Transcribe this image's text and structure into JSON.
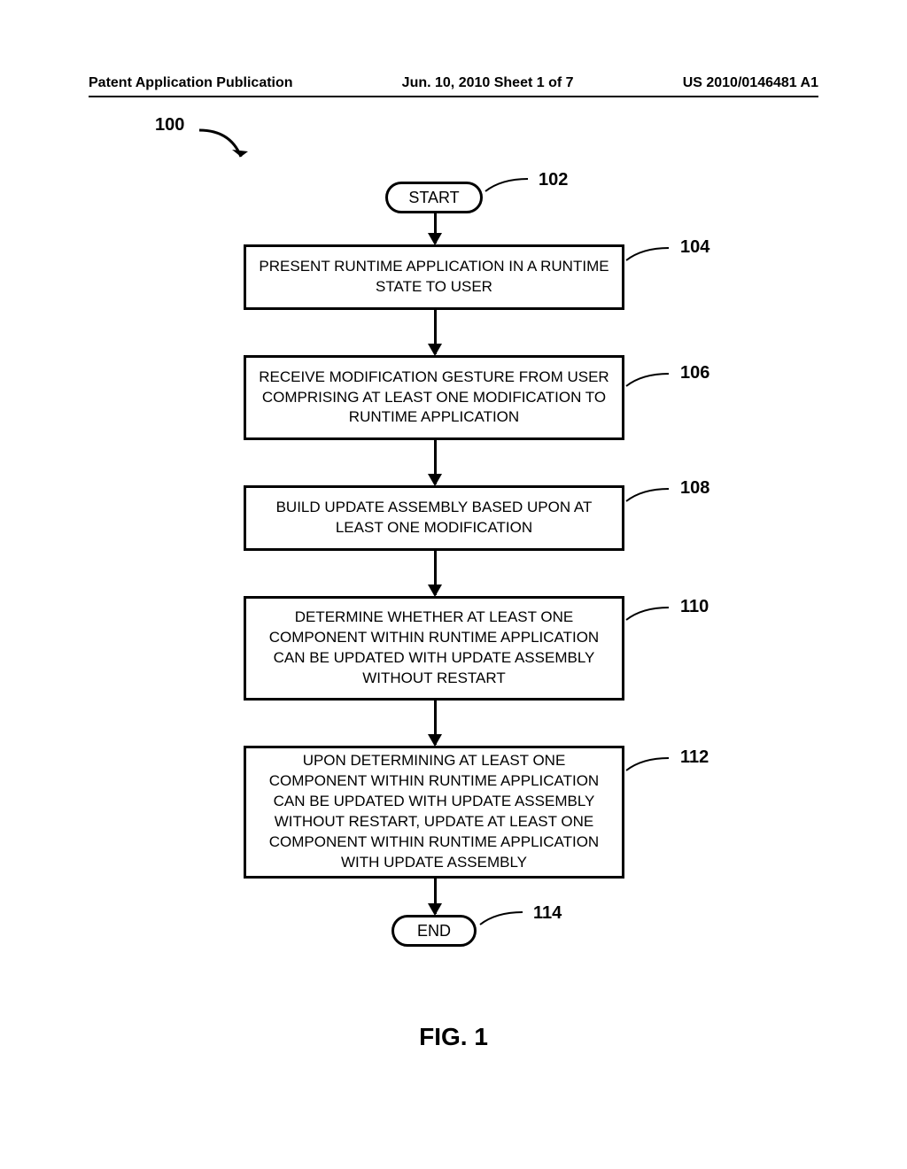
{
  "header": {
    "left": "Patent Application Publication",
    "center": "Jun. 10, 2010  Sheet 1 of 7",
    "right": "US 2010/0146481 A1"
  },
  "flow": {
    "ref100": "100",
    "start": {
      "label": "START",
      "ref": "102"
    },
    "step1": {
      "label": "PRESENT RUNTIME APPLICATION IN A RUNTIME STATE TO USER",
      "ref": "104"
    },
    "step2": {
      "label": "RECEIVE MODIFICATION GESTURE FROM USER COMPRISING AT LEAST ONE MODIFICATION TO RUNTIME APPLICATION",
      "ref": "106"
    },
    "step3": {
      "label": "BUILD UPDATE ASSEMBLY BASED UPON AT LEAST ONE MODIFICATION",
      "ref": "108"
    },
    "step4": {
      "label": "DETERMINE WHETHER AT LEAST ONE COMPONENT WITHIN RUNTIME APPLICATION CAN BE UPDATED WITH UPDATE ASSEMBLY WITHOUT RESTART",
      "ref": "110"
    },
    "step5": {
      "label": "UPON DETERMINING AT LEAST ONE COMPONENT WITHIN RUNTIME APPLICATION CAN BE UPDATED WITH UPDATE ASSEMBLY WITHOUT RESTART, UPDATE AT LEAST ONE COMPONENT WITHIN RUNTIME APPLICATION WITH UPDATE ASSEMBLY",
      "ref": "112"
    },
    "end": {
      "label": "END",
      "ref": "114"
    }
  },
  "figure_label": "FIG. 1"
}
